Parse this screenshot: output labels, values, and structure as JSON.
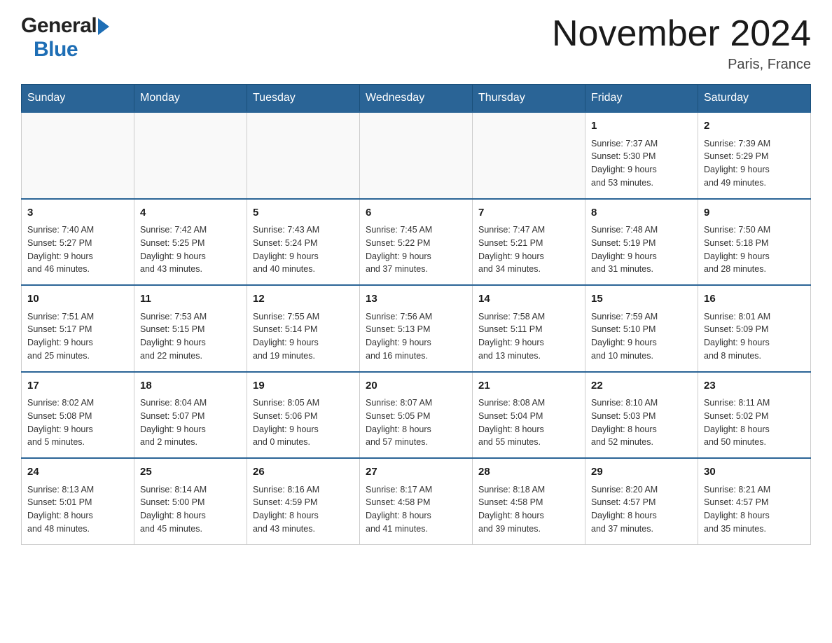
{
  "header": {
    "month_title": "November 2024",
    "location": "Paris, France",
    "logo_general": "General",
    "logo_blue": "Blue"
  },
  "weekdays": [
    "Sunday",
    "Monday",
    "Tuesday",
    "Wednesday",
    "Thursday",
    "Friday",
    "Saturday"
  ],
  "weeks": [
    [
      {
        "day": "",
        "info": ""
      },
      {
        "day": "",
        "info": ""
      },
      {
        "day": "",
        "info": ""
      },
      {
        "day": "",
        "info": ""
      },
      {
        "day": "",
        "info": ""
      },
      {
        "day": "1",
        "info": "Sunrise: 7:37 AM\nSunset: 5:30 PM\nDaylight: 9 hours\nand 53 minutes."
      },
      {
        "day": "2",
        "info": "Sunrise: 7:39 AM\nSunset: 5:29 PM\nDaylight: 9 hours\nand 49 minutes."
      }
    ],
    [
      {
        "day": "3",
        "info": "Sunrise: 7:40 AM\nSunset: 5:27 PM\nDaylight: 9 hours\nand 46 minutes."
      },
      {
        "day": "4",
        "info": "Sunrise: 7:42 AM\nSunset: 5:25 PM\nDaylight: 9 hours\nand 43 minutes."
      },
      {
        "day": "5",
        "info": "Sunrise: 7:43 AM\nSunset: 5:24 PM\nDaylight: 9 hours\nand 40 minutes."
      },
      {
        "day": "6",
        "info": "Sunrise: 7:45 AM\nSunset: 5:22 PM\nDaylight: 9 hours\nand 37 minutes."
      },
      {
        "day": "7",
        "info": "Sunrise: 7:47 AM\nSunset: 5:21 PM\nDaylight: 9 hours\nand 34 minutes."
      },
      {
        "day": "8",
        "info": "Sunrise: 7:48 AM\nSunset: 5:19 PM\nDaylight: 9 hours\nand 31 minutes."
      },
      {
        "day": "9",
        "info": "Sunrise: 7:50 AM\nSunset: 5:18 PM\nDaylight: 9 hours\nand 28 minutes."
      }
    ],
    [
      {
        "day": "10",
        "info": "Sunrise: 7:51 AM\nSunset: 5:17 PM\nDaylight: 9 hours\nand 25 minutes."
      },
      {
        "day": "11",
        "info": "Sunrise: 7:53 AM\nSunset: 5:15 PM\nDaylight: 9 hours\nand 22 minutes."
      },
      {
        "day": "12",
        "info": "Sunrise: 7:55 AM\nSunset: 5:14 PM\nDaylight: 9 hours\nand 19 minutes."
      },
      {
        "day": "13",
        "info": "Sunrise: 7:56 AM\nSunset: 5:13 PM\nDaylight: 9 hours\nand 16 minutes."
      },
      {
        "day": "14",
        "info": "Sunrise: 7:58 AM\nSunset: 5:11 PM\nDaylight: 9 hours\nand 13 minutes."
      },
      {
        "day": "15",
        "info": "Sunrise: 7:59 AM\nSunset: 5:10 PM\nDaylight: 9 hours\nand 10 minutes."
      },
      {
        "day": "16",
        "info": "Sunrise: 8:01 AM\nSunset: 5:09 PM\nDaylight: 9 hours\nand 8 minutes."
      }
    ],
    [
      {
        "day": "17",
        "info": "Sunrise: 8:02 AM\nSunset: 5:08 PM\nDaylight: 9 hours\nand 5 minutes."
      },
      {
        "day": "18",
        "info": "Sunrise: 8:04 AM\nSunset: 5:07 PM\nDaylight: 9 hours\nand 2 minutes."
      },
      {
        "day": "19",
        "info": "Sunrise: 8:05 AM\nSunset: 5:06 PM\nDaylight: 9 hours\nand 0 minutes."
      },
      {
        "day": "20",
        "info": "Sunrise: 8:07 AM\nSunset: 5:05 PM\nDaylight: 8 hours\nand 57 minutes."
      },
      {
        "day": "21",
        "info": "Sunrise: 8:08 AM\nSunset: 5:04 PM\nDaylight: 8 hours\nand 55 minutes."
      },
      {
        "day": "22",
        "info": "Sunrise: 8:10 AM\nSunset: 5:03 PM\nDaylight: 8 hours\nand 52 minutes."
      },
      {
        "day": "23",
        "info": "Sunrise: 8:11 AM\nSunset: 5:02 PM\nDaylight: 8 hours\nand 50 minutes."
      }
    ],
    [
      {
        "day": "24",
        "info": "Sunrise: 8:13 AM\nSunset: 5:01 PM\nDaylight: 8 hours\nand 48 minutes."
      },
      {
        "day": "25",
        "info": "Sunrise: 8:14 AM\nSunset: 5:00 PM\nDaylight: 8 hours\nand 45 minutes."
      },
      {
        "day": "26",
        "info": "Sunrise: 8:16 AM\nSunset: 4:59 PM\nDaylight: 8 hours\nand 43 minutes."
      },
      {
        "day": "27",
        "info": "Sunrise: 8:17 AM\nSunset: 4:58 PM\nDaylight: 8 hours\nand 41 minutes."
      },
      {
        "day": "28",
        "info": "Sunrise: 8:18 AM\nSunset: 4:58 PM\nDaylight: 8 hours\nand 39 minutes."
      },
      {
        "day": "29",
        "info": "Sunrise: 8:20 AM\nSunset: 4:57 PM\nDaylight: 8 hours\nand 37 minutes."
      },
      {
        "day": "30",
        "info": "Sunrise: 8:21 AM\nSunset: 4:57 PM\nDaylight: 8 hours\nand 35 minutes."
      }
    ]
  ]
}
